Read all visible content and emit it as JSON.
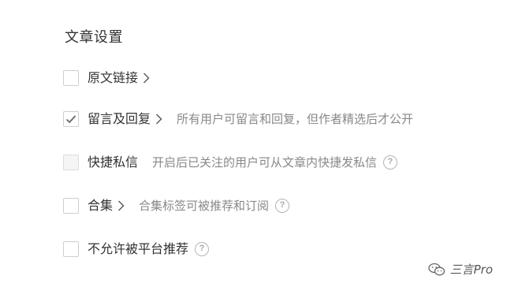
{
  "section": {
    "title": "文章设置"
  },
  "settings": [
    {
      "label": "原文链接",
      "checked": false,
      "disabled": false,
      "has_chevron": true,
      "description": "",
      "has_help": false
    },
    {
      "label": "留言及回复",
      "checked": true,
      "disabled": false,
      "has_chevron": true,
      "description": "所有用户可留言和回复，但作者精选后才公开",
      "has_help": false
    },
    {
      "label": "快捷私信",
      "checked": false,
      "disabled": true,
      "has_chevron": false,
      "description": "开启后已关注的用户可从文章内快捷发私信",
      "has_help": true
    },
    {
      "label": "合集",
      "checked": false,
      "disabled": false,
      "has_chevron": true,
      "description": "合集标签可被推荐和订阅",
      "has_help": true
    },
    {
      "label": "不允许被平台推荐",
      "checked": false,
      "disabled": false,
      "has_chevron": false,
      "description": "",
      "has_help": true
    }
  ],
  "icons": {
    "help_glyph": "?",
    "chevron": "chevron-right-icon",
    "check": "check-icon"
  },
  "watermark": {
    "text": "三言Pro",
    "icon": "wechat-icon"
  },
  "colors": {
    "text": "#333333",
    "description": "#888888",
    "checkbox_border": "#cfcfcf",
    "check_mark": "#666666"
  }
}
